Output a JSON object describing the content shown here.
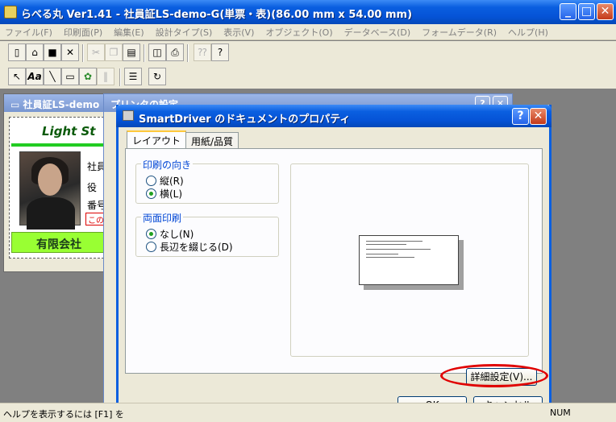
{
  "window": {
    "title": "らべる丸 Ver1.41 - 社員証LS-demo-G(単票・表)(86.00 mm x 54.00 mm)",
    "minimize": "_",
    "maximize": "□",
    "close": "✕"
  },
  "menu": [
    "ファイル(F)",
    "印刷面(P)",
    "編集(E)",
    "設計タイプ(S)",
    "表示(V)",
    "オブジェクト(O)",
    "データベース(D)",
    "フォームデータ(R)",
    "ヘルプ(H)"
  ],
  "toolbar1": [
    "new-icon",
    "open-icon",
    "save-icon",
    "delete-icon",
    "cut-icon",
    "copy-icon",
    "paste-icon",
    "print-preview-icon",
    "print-icon",
    "help-context-icon",
    "help-icon"
  ],
  "toolbar2": [
    "select-arrow-icon",
    "text-tool-icon",
    "line-tool-icon",
    "rect-tool-icon",
    "image-tool-icon",
    "barcode-tool-icon",
    "list-icon",
    "refresh-icon"
  ],
  "docwin": {
    "title": "社員証LS-demo",
    "card_title": "Light St",
    "card_lines": [
      "社員",
      "役",
      "番号"
    ],
    "card_red": "この",
    "card_footer": "有限会社"
  },
  "printwin": {
    "title": "プリンタの設定",
    "help": "?",
    "close": "✕"
  },
  "dialog": {
    "title": "SmartDriver のドキュメントのプロパティ",
    "help": "?",
    "close": "✕",
    "tabs": [
      "レイアウト",
      "用紙/品質"
    ],
    "orientation_label": "印刷の向き",
    "orientation_options": [
      "縦(R)",
      "横(L)"
    ],
    "orientation_selected": 1,
    "duplex_label": "両面印刷",
    "duplex_options": [
      "なし(N)",
      "長辺を綴じる(D)"
    ],
    "duplex_selected": 0,
    "advanced_button": "詳細設定(V)...",
    "ok_button": "OK",
    "cancel_button": "キャンセル"
  },
  "status": {
    "text": "ヘルプを表示するには [F1] を",
    "num": "NUM"
  },
  "colors": {
    "titlebar": "#0a5fe0",
    "highlight": "#e00000",
    "card_footer": "#99ff33"
  }
}
